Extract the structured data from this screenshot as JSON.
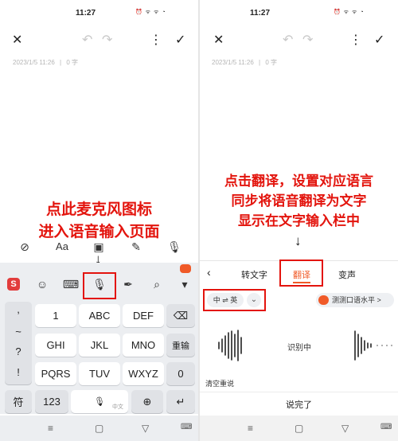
{
  "status_bar": {
    "time": "11:27",
    "icons_text": "⏰ ᯤ ᯤ ◔"
  },
  "editor": {
    "date": "2023/1/5 11:26",
    "separator": "|",
    "word_count": "0 字"
  },
  "left_caption": {
    "line1": "点此麦克风图标",
    "line2": "进入语音输入页面"
  },
  "right_caption": {
    "line1": "点击翻译，设置对应语言",
    "line2": "同步将语音翻译为文字",
    "line3": "显示在文字输入栏中"
  },
  "arrow_glyph": "↓",
  "toolbar": {
    "aa_label": "Aa"
  },
  "keyboard": {
    "row1": [
      ",",
      "1",
      "ABC",
      "DEF"
    ],
    "row2": [
      "~",
      "GHI",
      "JKL",
      "MNO",
      "重输"
    ],
    "row3": [
      "?",
      "PQRS",
      "TUV",
      "WXYZ",
      "0"
    ],
    "row4": [
      "!"
    ],
    "bottom": {
      "symbol": "符",
      "num": "123",
      "space_sub": "中文"
    }
  },
  "voice": {
    "tabs": [
      "转文字",
      "翻译",
      "变声"
    ],
    "active_tab": "翻译",
    "lang_pair": "中 ⇌ 英",
    "test_button": "测测口语水平 >",
    "recognizing": "识别中",
    "clear": "清空重说",
    "done": "说完了"
  },
  "nav_bar": {
    "menu": "≡",
    "home": "▢",
    "back": "▽"
  },
  "colors": {
    "accent": "#f05a28",
    "caption_red": "#e3140d",
    "icon_gray": "#c9c9c9"
  }
}
